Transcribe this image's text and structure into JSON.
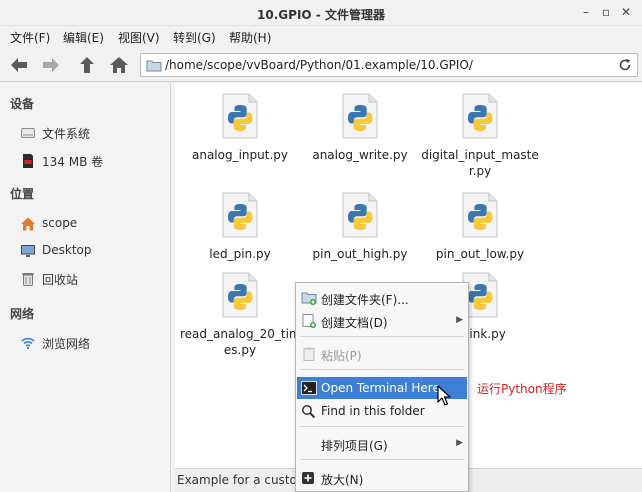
{
  "window": {
    "title": "10.GPIO - 文件管理器"
  },
  "menu": [
    "文件(F)",
    "编辑(E)",
    "视图(V)",
    "转到(G)",
    "帮助(H)"
  ],
  "address": {
    "path": "/home/scope/vvBoard/Python/01.example/10.GPIO/"
  },
  "sidebar": {
    "sections": [
      {
        "heading": "设备",
        "items": [
          {
            "label": "文件系统",
            "icon": "harddisk-icon"
          },
          {
            "label": "134 MB 卷",
            "icon": "sdcard-icon"
          }
        ]
      },
      {
        "heading": "位置",
        "items": [
          {
            "label": "scope",
            "icon": "home-icon"
          },
          {
            "label": "Desktop",
            "icon": "desktop-icon"
          },
          {
            "label": "回收站",
            "icon": "trash-icon"
          }
        ]
      },
      {
        "heading": "网络",
        "items": [
          {
            "label": "浏览网络",
            "icon": "wifi-icon"
          }
        ]
      }
    ]
  },
  "files": [
    {
      "name": "analog_input.py"
    },
    {
      "name": "analog_write.py"
    },
    {
      "name": "digital_input_master.py",
      "line1": "digital_input_maste",
      "line2": "r.py"
    },
    {
      "name": "led_pin.py"
    },
    {
      "name": "pin_out_high.py"
    },
    {
      "name": "pin_out_low.py"
    },
    {
      "name": "read_analog_20_times.py",
      "line1": "read_analog_20_tim",
      "line2": "es.py"
    },
    {
      "name": "-blink.py"
    }
  ],
  "statusbar": {
    "text": "Example for a custom"
  },
  "context_menu": {
    "items": [
      {
        "label": "创建文件夹(F)...",
        "icon": "new-folder-icon"
      },
      {
        "label": "创建文档(D)",
        "icon": "new-document-icon",
        "submenu": true
      },
      {
        "label": "粘贴(P)",
        "icon": "paste-icon",
        "disabled": true
      },
      {
        "label": "Open Terminal Here",
        "icon": "terminal-icon",
        "active": true
      },
      {
        "label": "Find in this folder",
        "icon": "search-icon"
      },
      {
        "label": "排列项目(G)",
        "submenu": true
      },
      {
        "label": "放大(N)",
        "icon": "zoom-in-icon"
      }
    ]
  },
  "annotation": {
    "text": "运行Python程序",
    "color": "#d42020"
  },
  "colors": {
    "accent": "#3e7fd6",
    "python_blue": "#3a76b0",
    "python_yellow": "#f7c83a"
  }
}
